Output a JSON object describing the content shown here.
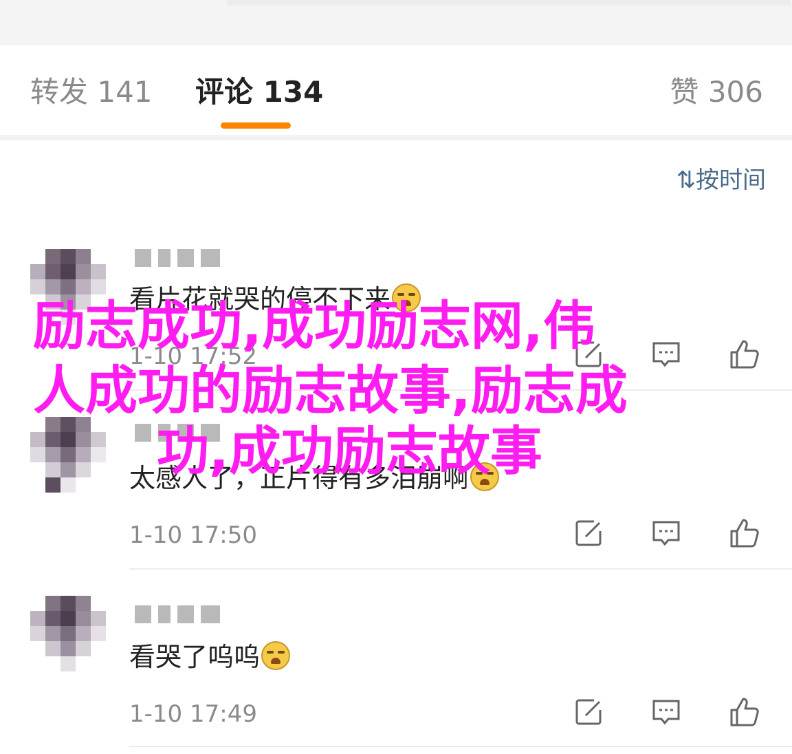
{
  "tabs": {
    "reposts": "转发 141",
    "comments": "评论 134",
    "likes": "赞 306",
    "underline_color": "#ff8200"
  },
  "sort": {
    "icon": "sort-icon",
    "label": "按时间"
  },
  "comments": [
    {
      "text": "看片花就哭的停不下来",
      "time": "1-10 17:52"
    },
    {
      "text": "太感人了，正片得有多泪崩啊",
      "time": "1-10 17:50"
    },
    {
      "text": "看哭了呜呜",
      "time": "1-10 17:49"
    }
  ],
  "actions": {
    "repost_icon": "repost-icon",
    "reply_icon": "comment-icon",
    "like_icon": "thumbs-up-icon"
  },
  "overlay": {
    "line1": "励志成功,成功励志网,伟",
    "line2": "人成功的励志故事,励志成",
    "line3": "功,成功励志故事",
    "color": "#ff1cf1"
  }
}
